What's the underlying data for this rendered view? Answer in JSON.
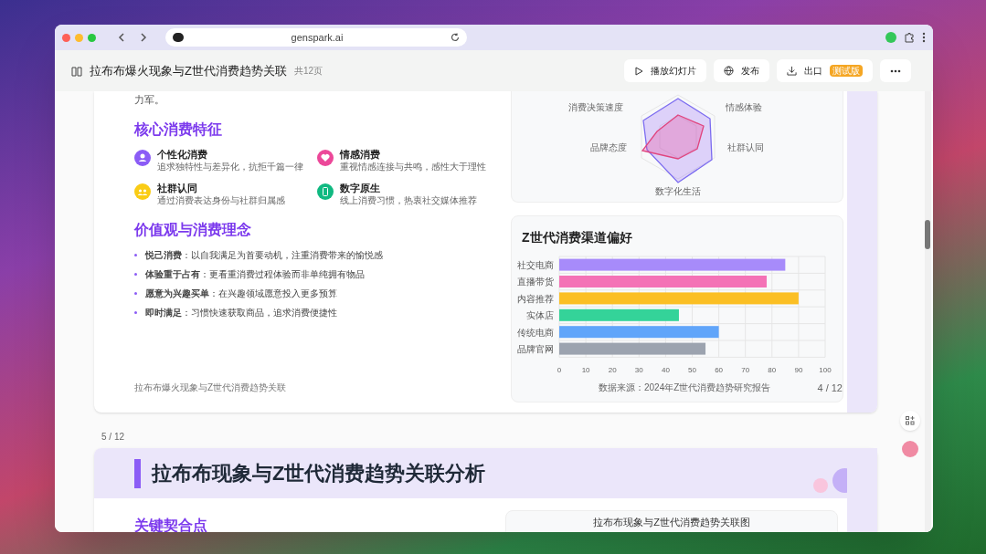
{
  "browser": {
    "url": "genspark.ai"
  },
  "header": {
    "title": "拉布布爆火现象与Z世代消费趋势关联",
    "page_count": "共12页",
    "buttons": [
      {
        "kind": "play",
        "label": "播放幻灯片"
      },
      {
        "kind": "publish",
        "label": "发布"
      },
      {
        "kind": "export",
        "label": "出口",
        "badge": "测试版"
      },
      {
        "kind": "more"
      }
    ]
  },
  "slide_4": {
    "intro_tail": "力军。",
    "section_1": "核心消费特征",
    "features": [
      {
        "kind": "person",
        "color": "#8b5cf6",
        "title": "个性化消费",
        "desc": "追求独特性与差异化，抗拒千篇一律"
      },
      {
        "kind": "heart",
        "color": "#ec4899",
        "title": "情感消费",
        "desc": "重视情感连接与共鸣，感性大于理性"
      },
      {
        "kind": "group",
        "color": "#facc15",
        "title": "社群认同",
        "desc": "通过消费表达身份与社群归属感"
      },
      {
        "kind": "phone",
        "color": "#10b981",
        "title": "数字原生",
        "desc": "线上消费习惯，热衷社交媒体推荐"
      }
    ],
    "section_2": "价值观与消费理念",
    "values": [
      "**悦己消费**：以自我满足为首要动机，注重消费带来的愉悦感",
      "**体验重于占有**：更看重消费过程体验而非单纯拥有物品",
      "**愿意为兴趣买单**：在兴趣领域愿意投入更多预算",
      "**即时满足**：习惯快速获取商品，追求消费便捷性"
    ],
    "footer": "拉布布爆火现象与Z世代消费趋势关联",
    "radar": {
      "labels": [
        "消费决策速度",
        "情感体验",
        "社群认同",
        "数字化生活",
        "品牌态度"
      ]
    },
    "bar_card": {
      "title": "Z世代消费渠道偏好",
      "chart_data": {
        "type": "bar",
        "orientation": "horizontal",
        "categories": [
          "社交电商",
          "直播带货",
          "内容推荐",
          "实体店",
          "传统电商",
          "品牌官网"
        ],
        "values": [
          85,
          78,
          90,
          45,
          60,
          55
        ],
        "grid": true,
        "colors": [
          "#a78bfa",
          "#f472b6",
          "#fbbf24",
          "#34d399",
          "#60a5fa",
          "#9ca3af"
        ],
        "xlim": [
          0,
          100
        ],
        "xticks": [
          0,
          10,
          20,
          30,
          40,
          50,
          60,
          70,
          80,
          90,
          100
        ]
      },
      "source": "数据来源：2024年Z世代消费趋势研究报告",
      "page": "4 / 12"
    }
  },
  "slide_5": {
    "label": "5 / 12",
    "title": "拉布布现象与Z世代消费趋势关联分析",
    "section_1": "关键契合点",
    "card_title": "拉布布现象与Z世代消费趋势关联图"
  }
}
